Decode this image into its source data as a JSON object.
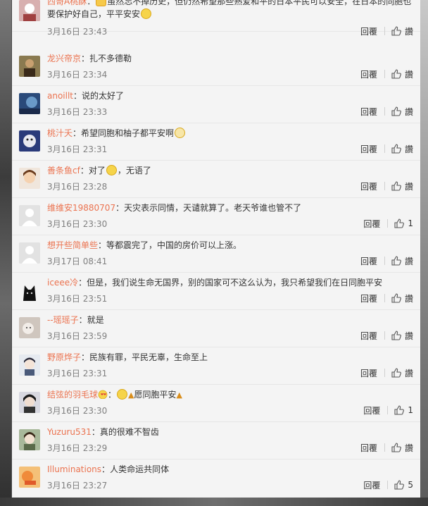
{
  "comments": [
    {
      "user": "西哥A桃酥",
      "line1_text": "虽然忘不掉历史，但仍然希望那些熟爱和平的日本平民可以安全，在日本的同胞也",
      "line2_text": "要保护好自己，平平安安",
      "time": "3月16日 23:43",
      "reply": "回覆",
      "like": "讚",
      "avatar_color": "#a88",
      "top_partial": true
    },
    {
      "user": "龙兴帝京",
      "text": "扎不多德勒",
      "time": "3月16日 23:34",
      "reply": "回覆",
      "like": "讚",
      "avatar_color": "#6b5a3a"
    },
    {
      "user": "anoillt",
      "text": "说的太好了",
      "time": "3月16日 23:33",
      "reply": "回覆",
      "like": "讚",
      "avatar_color": "#3b5a8a"
    },
    {
      "user": "桃汁夭",
      "text": "希望同胞和柚子都平安啊",
      "time": "3月16日 23:31",
      "reply": "回覆",
      "like": "讚",
      "avatar_color": "#3a4a8a"
    },
    {
      "user": "善条鱼cf",
      "text": "对了",
      "text_after": "，无语了",
      "time": "3月16日 23:28",
      "reply": "回覆",
      "like": "讚",
      "avatar_color": "#c9a06a"
    },
    {
      "user": "维维安19880707",
      "text": "天灾表示同情，天谴就算了。老天爷谁也管不了",
      "time": "3月16日 23:30",
      "reply": "回覆",
      "like": "1",
      "avatar_color": "#dcdcdc"
    },
    {
      "user": "想开些简单些",
      "text": "等都震完了，中国的房价可以上涨。",
      "time": "3月17日 08:41",
      "reply": "回覆",
      "like": "讚",
      "avatar_color": "#dcdcdc"
    },
    {
      "user": "iceee冷",
      "text": "但是，我们说生命无国界，别的国家可不这么认为，我只希望我们在日同胞平安",
      "time": "3月16日 23:51",
      "reply": "回覆",
      "like": "讚",
      "avatar_color": "#222"
    },
    {
      "user": "--瑶瑶子",
      "text": "就是",
      "time": "3月16日 23:59",
      "reply": "回覆",
      "like": "讚",
      "avatar_color": "#b9a99a"
    },
    {
      "user": "野原烨子",
      "text": "民族有罪，平民无辜，生命至上",
      "time": "3月16日 23:31",
      "reply": "回覆",
      "like": "讚",
      "avatar_color": "#dfe3ea"
    },
    {
      "user": "结弦的羽毛球",
      "text": "",
      "text_after": "愿同胞平安",
      "time": "3月16日 23:30",
      "reply": "回覆",
      "like": "1",
      "avatar_color": "#444"
    },
    {
      "user": "Yuzuru531",
      "text": "真的很难不智齿",
      "time": "3月16日 23:29",
      "reply": "回覆",
      "like": "讚",
      "avatar_color": "#7a8a6a"
    },
    {
      "user": "Illuminations",
      "text": "人类命运共同体",
      "time": "3月16日 23:27",
      "reply": "回覆",
      "like": "5",
      "avatar_color": "#f0b060"
    }
  ],
  "colors": {
    "username": "#eb7350",
    "time": "#808080",
    "text": "#333333",
    "panel": "#f4f4f4"
  }
}
